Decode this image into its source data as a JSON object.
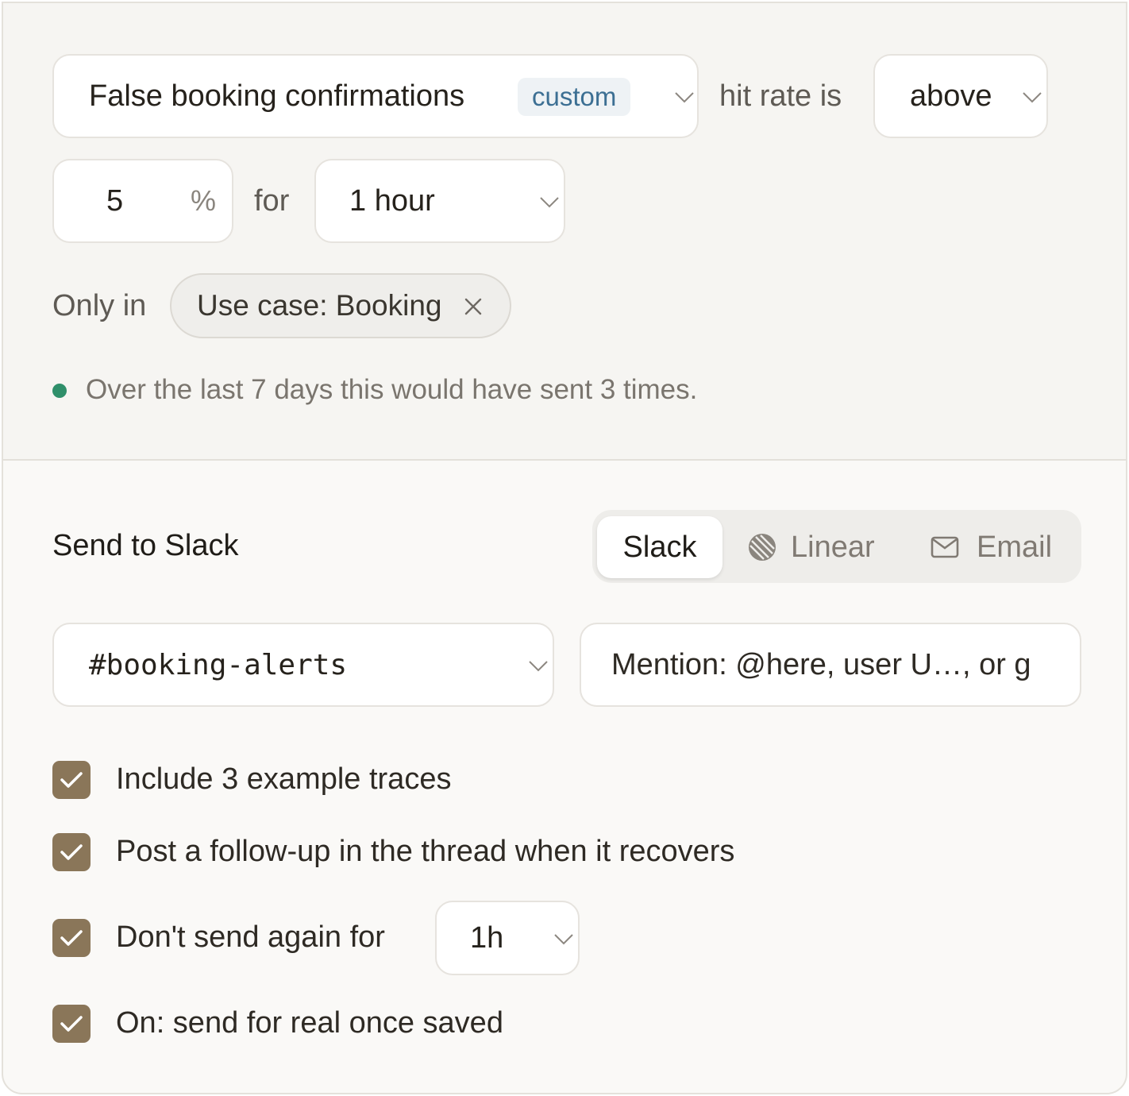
{
  "condition": {
    "metric": "False booking confirmations",
    "metric_badge": "custom",
    "hit_rate_label": "hit rate is",
    "comparator": "above",
    "threshold_value": "5",
    "threshold_unit": "%",
    "for_label": "for",
    "duration": "1 hour",
    "only_in_label": "Only in",
    "filter_chip": "Use case: Booking",
    "preview_text": "Over the last 7 days this would have sent 3 times."
  },
  "destination": {
    "heading": "Send to Slack",
    "tabs": [
      {
        "label": "Slack",
        "icon": "slack",
        "active": true
      },
      {
        "label": "Linear",
        "icon": "linear-icon",
        "active": false
      },
      {
        "label": "Email",
        "icon": "mail-icon",
        "active": false
      }
    ],
    "channel": "#booking-alerts",
    "mention_placeholder": "Mention: @here, user U…, or g"
  },
  "options": {
    "include_traces": {
      "label": "Include 3 example traces",
      "checked": true
    },
    "follow_up": {
      "label": "Post a follow-up in the thread when it recovers",
      "checked": true
    },
    "cooldown": {
      "label": "Don't send again for",
      "checked": true,
      "value": "1h"
    },
    "send_real": {
      "label": "On: send for real once saved",
      "checked": true
    }
  },
  "colors": {
    "status_dot": "#2f8f6a",
    "checkbox": "#8a7659",
    "badge_text": "#3c6f93"
  }
}
